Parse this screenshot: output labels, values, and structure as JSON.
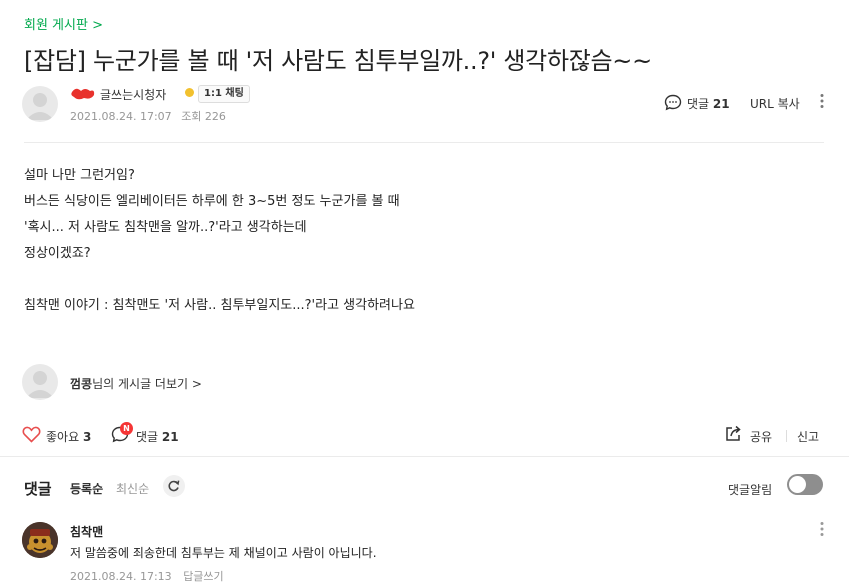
{
  "board": {
    "name": "회원 게시판 >"
  },
  "post": {
    "title": "[잡담] 누군가를 볼 때 '저 사람도 침투부일까..?' 생각하잖슴~~",
    "author": {
      "nickname": "글쓰는시청자",
      "chat_badge": "1:1 채팅"
    },
    "date": "2021.08.24. 17:07",
    "views": "조회 226",
    "comment_label": "댓글",
    "comment_count": "21",
    "url_copy": "URL 복사",
    "body": [
      "설마 나만 그런거임?",
      "버스든 식당이든 엘리베이터든 하루에 한 3~5번 정도 누군가를 볼 때",
      "'혹시... 저 사람도 침착맨을 알까..?'라고 생각하는데",
      "정상이겠죠?",
      "",
      "침착맨 이야기 : 침착맨도 '저 사람.. 침투부일지도...?'라고 생각하려나요"
    ]
  },
  "profile": {
    "name": "껌콩",
    "suffix": "님의 게시글 더보기 >"
  },
  "actions": {
    "like_label": "좋아요",
    "like_count": "3",
    "new_badge": "N",
    "comment_label": "댓글",
    "comment_count": "21",
    "share": "공유",
    "report": "신고"
  },
  "comments": {
    "header": "댓글",
    "sort_registered": "등록순",
    "sort_newest": "최신순",
    "alarm_label": "댓글알림",
    "alarm_on": false,
    "items": [
      {
        "nickname": "침착맨",
        "text": "저 말씀중에 죄송한데 침투부는 제 채널이고 사람이 아닙니다.",
        "date": "2021.08.24. 17:13",
        "reply": "답글쓰기"
      }
    ]
  },
  "colors": {
    "board_green": "#03a94e",
    "heart_red": "#e84e4e",
    "badge_red": "#f53535",
    "meta_gray": "#979797",
    "toggle_off": "#8e8e8e"
  },
  "icons": [
    "gear-icon",
    "heart-icon",
    "comment-icon",
    "share-icon",
    "kebab-icon",
    "refresh-icon"
  ]
}
